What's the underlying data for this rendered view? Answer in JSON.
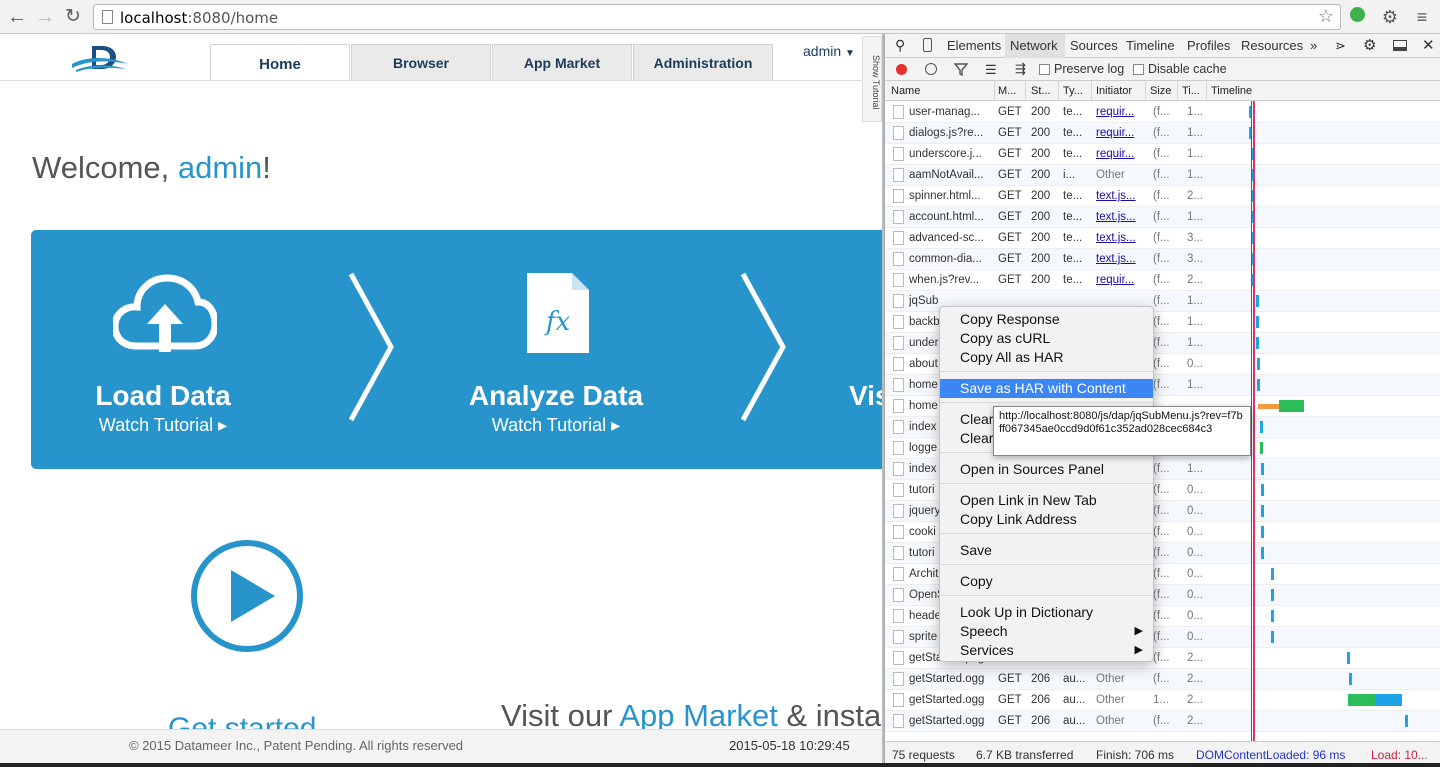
{
  "browser": {
    "url_host": "localhost",
    "url_rest": ":8080/home"
  },
  "app": {
    "nav": {
      "tabs": [
        {
          "label": "Home"
        },
        {
          "label": "Browser"
        },
        {
          "label": "App Market"
        },
        {
          "label": "Administration"
        }
      ],
      "user": "admin",
      "show_tutorial": "Show Tutorial"
    },
    "welcome": {
      "prefix": "Welcome, ",
      "user": "admin",
      "suffix": "!"
    },
    "steps": [
      {
        "title": "Load Data",
        "sub": "Watch Tutorial ▸"
      },
      {
        "title": "Analyze Data",
        "sub": "Watch Tutorial ▸"
      },
      {
        "title": "Vis",
        "sub": ""
      }
    ],
    "get_started": "Get started",
    "visit": {
      "pre": "Visit our ",
      "link": "App Market",
      "post": " & insta"
    },
    "footer": {
      "copyright": "© 2015 Datameer Inc., Patent Pending. All rights reserved",
      "datetime": "2015-05-18 10:29:45"
    }
  },
  "devtools": {
    "tabs": [
      "Elements",
      "Network",
      "Sources",
      "Timeline",
      "Profiles",
      "Resources"
    ],
    "active_tab": "Network",
    "more": "»",
    "toolbar": {
      "preserve_log": "Preserve log",
      "disable_cache": "Disable cache"
    },
    "columns": [
      "Name",
      "M...",
      "St...",
      "Ty...",
      "Initiator",
      "Size",
      "Ti...",
      "Timeline"
    ],
    "rows": [
      {
        "name": "user-manag...",
        "m": "GET",
        "s": "200",
        "t": "te...",
        "i": "requir...",
        "il": true,
        "sz": "(f...",
        "ti": "1...",
        "tl": 0.17,
        "tw": 0.006,
        "c": "#1ea3e6"
      },
      {
        "name": "dialogs.js?re...",
        "m": "GET",
        "s": "200",
        "t": "te...",
        "i": "requir...",
        "il": true,
        "sz": "(f...",
        "ti": "1...",
        "tl": 0.17,
        "tw": 0.006,
        "c": "#1ea3e6"
      },
      {
        "name": "underscore.j...",
        "m": "GET",
        "s": "200",
        "t": "te...",
        "i": "requir...",
        "il": true,
        "sz": "(f...",
        "ti": "1...",
        "tl": 0.175,
        "tw": 0.006,
        "c": "#1ea3e6"
      },
      {
        "name": "aamNotAvail...",
        "m": "GET",
        "s": "200",
        "t": "i...",
        "i": "Other",
        "il": false,
        "sz": "(f...",
        "ti": "1...",
        "tl": 0.175,
        "tw": 0.006,
        "c": "#1ea3e6"
      },
      {
        "name": "spinner.html...",
        "m": "GET",
        "s": "200",
        "t": "te...",
        "i": "text.js...",
        "il": true,
        "sz": "(f...",
        "ti": "2...",
        "tl": 0.175,
        "tw": 0.006,
        "c": "#1ea3e6"
      },
      {
        "name": "account.html...",
        "m": "GET",
        "s": "200",
        "t": "te...",
        "i": "text.js...",
        "il": true,
        "sz": "(f...",
        "ti": "1...",
        "tl": 0.178,
        "tw": 0.006,
        "c": "#1ea3e6"
      },
      {
        "name": "advanced-sc...",
        "m": "GET",
        "s": "200",
        "t": "te...",
        "i": "text.js...",
        "il": true,
        "sz": "(f...",
        "ti": "3...",
        "tl": 0.178,
        "tw": 0.006,
        "c": "#1ea3e6"
      },
      {
        "name": "common-dia...",
        "m": "GET",
        "s": "200",
        "t": "te...",
        "i": "text.js...",
        "il": true,
        "sz": "(f...",
        "ti": "3...",
        "tl": 0.178,
        "tw": 0.006,
        "c": "#1ea3e6"
      },
      {
        "name": "when.js?rev...",
        "m": "GET",
        "s": "200",
        "t": "te...",
        "i": "requir...",
        "il": true,
        "sz": "(f...",
        "ti": "2...",
        "tl": 0.178,
        "tw": 0.006,
        "c": "#1ea3e6"
      },
      {
        "name": "jqSub",
        "m": "",
        "s": "",
        "t": "",
        "i": "",
        "il": false,
        "sz": "(f...",
        "ti": "1...",
        "tl": 0.2,
        "tw": 0.006,
        "c": "#1ea3e6"
      },
      {
        "name": "backb",
        "m": "",
        "s": "",
        "t": "",
        "i": "",
        "il": false,
        "sz": "(f...",
        "ti": "1...",
        "tl": 0.2,
        "tw": 0.006,
        "c": "#1ea3e6"
      },
      {
        "name": "under",
        "m": "",
        "s": "",
        "t": "",
        "i": "",
        "il": false,
        "sz": "(f...",
        "ti": "1...",
        "tl": 0.2,
        "tw": 0.006,
        "c": "#1ea3e6"
      },
      {
        "name": "about",
        "m": "",
        "s": "",
        "t": "",
        "i": "",
        "il": false,
        "sz": "(f...",
        "ti": "0...",
        "tl": 0.205,
        "tw": 0.006,
        "c": "#1ea3e6"
      },
      {
        "name": "home",
        "m": "",
        "s": "",
        "t": "",
        "i": "",
        "il": false,
        "sz": "(f...",
        "ti": "1...",
        "tl": 0.205,
        "tw": 0.006,
        "c": "#1ea3e6"
      },
      {
        "name": "home",
        "m": "",
        "s": "",
        "t": "",
        "i": "",
        "il": false,
        "sz": "",
        "ti": "",
        "tl": 0.21,
        "tw": 0.2,
        "c": "split"
      },
      {
        "name": "index",
        "m": "",
        "s": "",
        "t": "",
        "i": "",
        "il": false,
        "sz": "",
        "ti": "",
        "tl": 0.215,
        "tw": 0.006,
        "c": "#1ea3e6"
      },
      {
        "name": "logge",
        "m": "",
        "s": "",
        "t": "",
        "i": "",
        "il": false,
        "sz": "",
        "ti": "",
        "tl": 0.215,
        "tw": 0.015,
        "c": "#2bbd5a"
      },
      {
        "name": "index",
        "m": "",
        "s": "",
        "t": "",
        "i": "",
        "il": false,
        "sz": "(f...",
        "ti": "1...",
        "tl": 0.22,
        "tw": 0.006,
        "c": "#1ea3e6"
      },
      {
        "name": "tutori",
        "m": "",
        "s": "",
        "t": "",
        "i": "",
        "il": false,
        "sz": "(f...",
        "ti": "0...",
        "tl": 0.22,
        "tw": 0.006,
        "c": "#1ea3e6"
      },
      {
        "name": "jquery",
        "m": "",
        "s": "",
        "t": "",
        "i": "",
        "il": false,
        "sz": "(f...",
        "ti": "0...",
        "tl": 0.22,
        "tw": 0.006,
        "c": "#1ea3e6"
      },
      {
        "name": "cooki",
        "m": "",
        "s": "",
        "t": "",
        "i": "",
        "il": false,
        "sz": "(f...",
        "ti": "0...",
        "tl": 0.22,
        "tw": 0.006,
        "c": "#1ea3e6"
      },
      {
        "name": "tutori",
        "m": "",
        "s": "",
        "t": "",
        "i": "",
        "il": false,
        "sz": "(f...",
        "ti": "0...",
        "tl": 0.22,
        "tw": 0.006,
        "c": "#1ea3e6"
      },
      {
        "name": "Archit",
        "m": "",
        "s": "",
        "t": "",
        "i": "",
        "il": false,
        "sz": "(f...",
        "ti": "0...",
        "tl": 0.265,
        "tw": 0.006,
        "c": "#1ea3e6"
      },
      {
        "name": "OpenS",
        "m": "",
        "s": "",
        "t": "",
        "i": "",
        "il": false,
        "sz": "(f...",
        "ti": "0...",
        "tl": 0.265,
        "tw": 0.006,
        "c": "#1ea3e6"
      },
      {
        "name": "heade",
        "m": "",
        "s": "",
        "t": "",
        "i": "",
        "il": false,
        "sz": "(f...",
        "ti": "0...",
        "tl": 0.265,
        "tw": 0.006,
        "c": "#1ea3e6"
      },
      {
        "name": "sprite",
        "m": "",
        "s": "",
        "t": "",
        "i": "",
        "il": false,
        "sz": "(f...",
        "ti": "0...",
        "tl": 0.265,
        "tw": 0.006,
        "c": "#1ea3e6"
      },
      {
        "name": "getStarted.png",
        "m": "GET",
        "s": "200",
        "t": "i...",
        "i": "Other",
        "il": false,
        "sz": "(f...",
        "ti": "2...",
        "tl": 0.6,
        "tw": 0.006,
        "c": "#1ea3e6"
      },
      {
        "name": "getStarted.ogg",
        "m": "GET",
        "s": "206",
        "t": "au...",
        "i": "Other",
        "il": false,
        "sz": "(f...",
        "ti": "2...",
        "tl": 0.61,
        "tw": 0.006,
        "c": "#1ea3e6"
      },
      {
        "name": "getStarted.ogg",
        "m": "GET",
        "s": "206",
        "t": "au...",
        "i": "Other",
        "il": false,
        "sz": "1...",
        "ti": "2...",
        "tl": 0.605,
        "tw": 0.24,
        "c": "green-blue"
      },
      {
        "name": "getStarted.ogg",
        "m": "GET",
        "s": "206",
        "t": "au...",
        "i": "Other",
        "il": false,
        "sz": "(f...",
        "ti": "2...",
        "tl": 0.86,
        "tw": 0.012,
        "c": "#1ea3e6"
      }
    ],
    "status": {
      "requests": "75 requests",
      "transferred": "6.7 KB transferred",
      "finish": "Finish: 706 ms",
      "dcl": "DOMContentLoaded: 96 ms",
      "load": "Load: 10..."
    },
    "colors": {
      "dcl": "#2233cc",
      "load": "#d0203a",
      "accent": "#3c86f4"
    }
  },
  "context_menu": {
    "items": [
      {
        "label": "Copy Response"
      },
      {
        "label": "Copy as cURL"
      },
      {
        "label": "Copy All as HAR"
      },
      {
        "label": "Save as HAR with Content",
        "selected": true
      },
      {
        "label": "Clear"
      },
      {
        "label": "Clear"
      },
      {
        "label": "Open in Sources Panel"
      },
      {
        "label": "Open Link in New Tab"
      },
      {
        "label": "Copy Link Address"
      },
      {
        "label": "Save"
      },
      {
        "label": "Copy"
      },
      {
        "label": "Look Up in Dictionary"
      },
      {
        "label": "Speech",
        "submenu": true
      },
      {
        "label": "Services",
        "submenu": true
      }
    ],
    "tooltip": "http://localhost:8080/js/dap/jqSubMenu.js?rev=f7bff067345ae0ccd9d0f61c352ad028cec684c3"
  }
}
